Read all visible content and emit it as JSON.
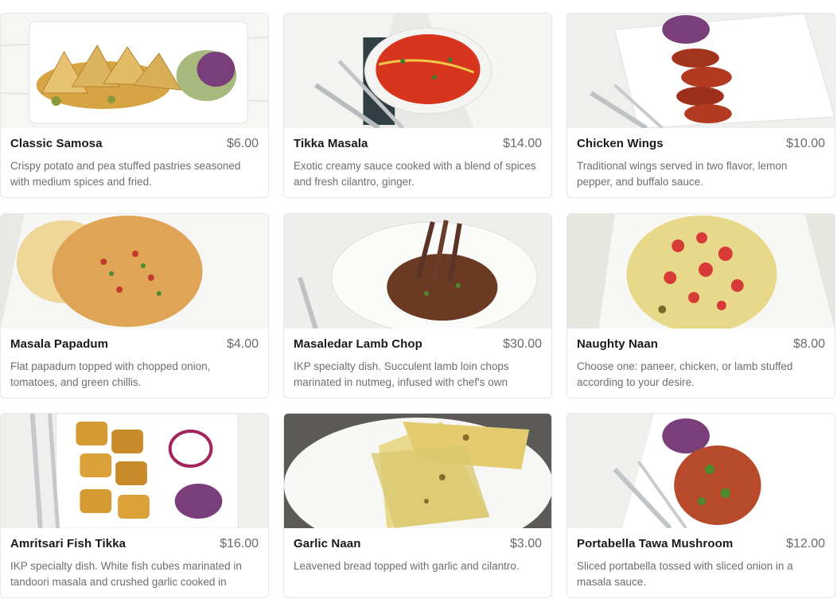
{
  "menu": {
    "items": [
      {
        "name": "Classic Samosa",
        "price": "$6.00",
        "description": "Crispy potato and pea stuffed pastries seasoned with medium spices and fried.",
        "photo": "samosa-plate-photo"
      },
      {
        "name": "Tikka Masala",
        "price": "$14.00",
        "description": "Exotic creamy sauce cooked with a blend of spices and fresh cilantro, ginger.",
        "photo": "tikka-masala-bowl-photo"
      },
      {
        "name": "Chicken Wings",
        "price": "$10.00",
        "description": "Traditional wings served in two flavor, lemon pepper, and buffalo sauce.",
        "photo": "chicken-wings-plate-photo"
      },
      {
        "name": "Masala Papadum",
        "price": "$4.00",
        "description": "Flat papadum topped with chopped onion, tomatoes, and green chillis.",
        "photo": "masala-papadum-photo"
      },
      {
        "name": "Masaledar Lamb Chop",
        "price": "$30.00",
        "description": "IKP specialty dish. Succulent lamb loin chops marinated in nutmeg, infused with chef's own",
        "photo": "lamb-chop-bowl-photo"
      },
      {
        "name": "Naughty Naan",
        "price": "$8.00",
        "description": "Choose one: paneer, chicken, or lamb stuffed according to your desire.",
        "photo": "naughty-naan-photo"
      },
      {
        "name": "Amritsari Fish Tikka",
        "price": "$16.00",
        "description": "IKP specialty dish. White fish cubes marinated in tandoori masala and crushed garlic cooked in",
        "photo": "fish-tikka-plate-photo"
      },
      {
        "name": "Garlic Naan",
        "price": "$3.00",
        "description": "Leavened bread topped with garlic and cilantro.",
        "photo": "garlic-naan-photo"
      },
      {
        "name": "Portabella Tawa Mushroom",
        "price": "$12.00",
        "description": "Sliced portabella tossed with sliced onion in a masala sauce.",
        "photo": "portabella-mushroom-photo"
      }
    ]
  }
}
